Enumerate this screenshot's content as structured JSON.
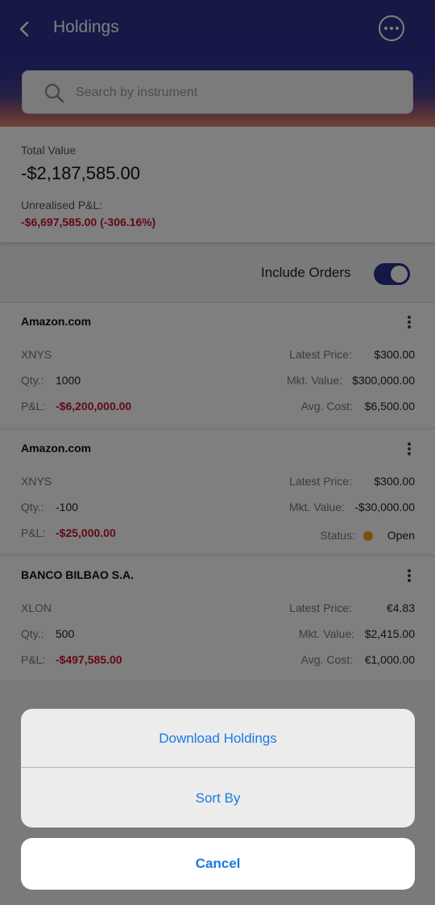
{
  "header": {
    "title": "Holdings",
    "back_icon": "chevron-left-icon",
    "more_icon": "more-horizontal-icon"
  },
  "search": {
    "placeholder": "Search by instrument",
    "value": ""
  },
  "summary": {
    "total_label": "Total Value",
    "total_value": "-$2,187,585.00",
    "pnl_label": "Unrealised P&L:",
    "pnl_value": "-$6,697,585.00 (-306.16%)"
  },
  "toggle": {
    "label": "Include Orders",
    "on": true
  },
  "holdings": [
    {
      "name": "Amazon.com",
      "exchange": "XNYS",
      "qty_label": "Qty.:",
      "qty": "1000",
      "pnl_label": "P&L:",
      "pnl": "-$6,200,000.00",
      "latest_label": "Latest Price:",
      "latest": "$300.00",
      "mkt_label": "Mkt. Value:",
      "mkt": "$300,000.00",
      "third_label": "Avg. Cost:",
      "third": "$6,500.00"
    },
    {
      "name": "Amazon.com",
      "exchange": "XNYS",
      "qty_label": "Qty.:",
      "qty": "-100",
      "pnl_label": "P&L:",
      "pnl": "-$25,000.00",
      "latest_label": "Latest Price:",
      "latest": "$300.00",
      "mkt_label": "Mkt. Value:",
      "mkt": "-$30,000.00",
      "third_label": "Status:",
      "third": "Open"
    },
    {
      "name": "BANCO BILBAO S.A.",
      "exchange": "XLON",
      "qty_label": "Qty.:",
      "qty": "500",
      "pnl_label": "P&L:",
      "pnl": "-$497,585.00",
      "latest_label": "Latest Price:",
      "latest": "€4.83",
      "mkt_label": "Mkt. Value:",
      "mkt": "$2,415.00",
      "third_label": "Avg. Cost:",
      "third": "€1,000.00"
    }
  ],
  "action_sheet": {
    "download_label": "Download Holdings",
    "sort_label": "Sort By",
    "cancel_label": "Cancel"
  },
  "colors": {
    "header": "#2b2f8c",
    "negative": "#c8102e",
    "action": "#1a7ae0",
    "status_open": "#f0a020"
  }
}
